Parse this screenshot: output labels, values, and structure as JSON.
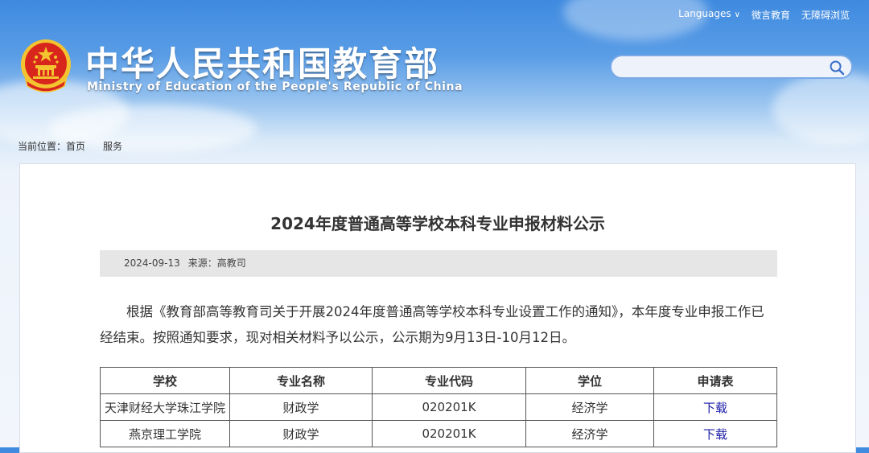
{
  "header": {
    "languages_label": "Languages",
    "weiyan_label": "微言教育",
    "accessibility_label": "无障碍浏览",
    "title_cn": "中华人民共和国教育部",
    "title_en": "Ministry of Education of the People's Republic of China",
    "search": {
      "value": "",
      "placeholder": ""
    }
  },
  "breadcrumb": {
    "prefix": "当前位置：",
    "home": "首页",
    "current": "服务"
  },
  "article": {
    "title": "2024年度普通高等学校本科专业申报材料公示",
    "date": "2024-09-13",
    "source": "来源：高教司",
    "paragraph": "根据《教育部高等教育司关于开展2024年度普通高等学校本科专业设置工作的通知》，本年度专业申报工作已经结束。按照通知要求，现对相关材料予以公示，公示期为9月13日-10月12日。"
  },
  "table": {
    "headers": [
      "学校",
      "专业名称",
      "专业代码",
      "学位",
      "申请表"
    ],
    "rows": [
      [
        "天津财经大学珠江学院",
        "财政学",
        "020201K",
        "经济学",
        "下载"
      ],
      [
        "燕京理工学院",
        "财政学",
        "020201K",
        "经济学",
        "下载"
      ]
    ]
  },
  "colors": {
    "sky_top": "#3f8ae0",
    "emblem_red": "#d9261c",
    "emblem_gold": "#f4c430",
    "link_blue": "#1a1aa6"
  }
}
